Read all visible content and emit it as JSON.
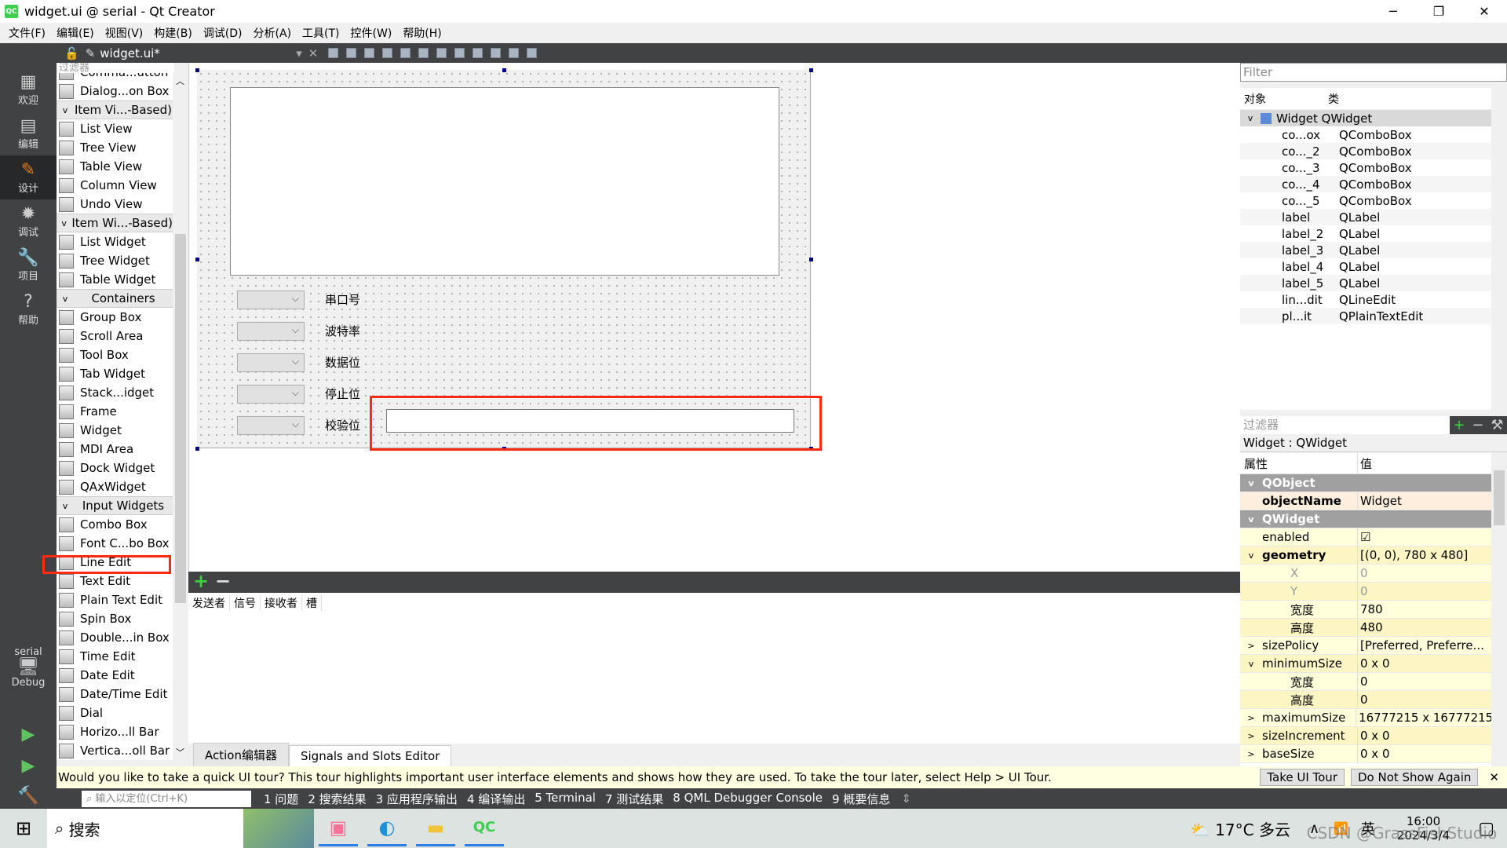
{
  "window": {
    "title": "widget.ui @ serial - Qt Creator",
    "minimize": "─",
    "maximize": "❐",
    "close": "✕",
    "logo": "QC"
  },
  "menu": [
    "文件(F)",
    "编辑(E)",
    "视图(V)",
    "构建(B)",
    "调试(D)",
    "分析(A)",
    "工具(T)",
    "控件(W)",
    "帮助(H)"
  ],
  "editor_toolbar": {
    "file": "widget.ui*",
    "dropdown": "▾",
    "close": "✕"
  },
  "modes": [
    {
      "label": "欢迎",
      "icon": "grid-icon"
    },
    {
      "label": "编辑",
      "icon": "edit-icon"
    },
    {
      "label": "设计",
      "icon": "pencil-icon",
      "active": true
    },
    {
      "label": "调试",
      "icon": "bug-icon"
    },
    {
      "label": "项目",
      "icon": "wrench-icon"
    },
    {
      "label": "帮助",
      "icon": "help-icon"
    }
  ],
  "kit": {
    "project": "serial",
    "config": "Debug"
  },
  "widget_box": {
    "filter_placeholder": "过滤器",
    "items": [
      {
        "label": "Comma...utton"
      },
      {
        "label": "Dialog...on Box"
      },
      {
        "label": "Item Vi...-Based)",
        "category": true
      },
      {
        "label": "List View"
      },
      {
        "label": "Tree View"
      },
      {
        "label": "Table View"
      },
      {
        "label": "Column View"
      },
      {
        "label": "Undo View"
      },
      {
        "label": "Item Wi...-Based)",
        "category": true
      },
      {
        "label": "List Widget"
      },
      {
        "label": "Tree Widget"
      },
      {
        "label": "Table Widget"
      },
      {
        "label": "Containers",
        "category": true
      },
      {
        "label": "Group Box"
      },
      {
        "label": "Scroll Area"
      },
      {
        "label": "Tool Box"
      },
      {
        "label": "Tab Widget"
      },
      {
        "label": "Stack...idget"
      },
      {
        "label": "Frame"
      },
      {
        "label": "Widget"
      },
      {
        "label": "MDI Area"
      },
      {
        "label": "Dock Widget"
      },
      {
        "label": "QAxWidget"
      },
      {
        "label": "Input Widgets",
        "category": true
      },
      {
        "label": "Combo Box"
      },
      {
        "label": "Font C...bo Box"
      },
      {
        "label": "Line Edit",
        "highlighted": true
      },
      {
        "label": "Text Edit"
      },
      {
        "label": "Plain Text Edit"
      },
      {
        "label": "Spin Box"
      },
      {
        "label": "Double...in Box"
      },
      {
        "label": "Time Edit"
      },
      {
        "label": "Date Edit"
      },
      {
        "label": "Date/Time Edit"
      },
      {
        "label": "Dial"
      },
      {
        "label": "Horizo...ll Bar"
      },
      {
        "label": "Vertica...oll Bar"
      }
    ]
  },
  "form": {
    "labels": [
      "串口号",
      "波特率",
      "数据位",
      "停止位",
      "校验位"
    ],
    "line_edit_value": "",
    "highlight_color": "#ff2a10"
  },
  "signals_slots": {
    "add": "+",
    "remove": "−",
    "columns": [
      "发送者",
      "信号",
      "接收者",
      "槽"
    ],
    "tabs": [
      "Action编辑器",
      "Signals and Slots Editor"
    ]
  },
  "object_inspector": {
    "filter_placeholder": "Filter",
    "columns": [
      "对象",
      "类"
    ],
    "root": {
      "name": "Widget",
      "class": "QWidget"
    },
    "children": [
      {
        "name": "co...ox",
        "class": "QComboBox"
      },
      {
        "name": "co..._2",
        "class": "QComboBox"
      },
      {
        "name": "co..._3",
        "class": "QComboBox"
      },
      {
        "name": "co..._4",
        "class": "QComboBox"
      },
      {
        "name": "co..._5",
        "class": "QComboBox"
      },
      {
        "name": "label",
        "class": "QLabel"
      },
      {
        "name": "label_2",
        "class": "QLabel"
      },
      {
        "name": "label_3",
        "class": "QLabel"
      },
      {
        "name": "label_4",
        "class": "QLabel"
      },
      {
        "name": "label_5",
        "class": "QLabel"
      },
      {
        "name": "lin...dit",
        "class": "QLineEdit"
      },
      {
        "name": "pl...it",
        "class": "QPlainTextEdit"
      }
    ]
  },
  "property_editor": {
    "filter_placeholder": "过滤器",
    "class_label": "Widget : QWidget",
    "columns": [
      "属性",
      "值"
    ],
    "rows": [
      {
        "name": "QObject",
        "group": true,
        "exp": "v"
      },
      {
        "name": "objectName",
        "value": "Widget",
        "bold": true,
        "sel": true
      },
      {
        "name": "QWidget",
        "group": true,
        "exp": "v"
      },
      {
        "name": "enabled",
        "value": "☑",
        "check": true
      },
      {
        "name": "geometry",
        "value": "[(0, 0), 780 x 480]",
        "bold": true,
        "exp": "v",
        "alt": true
      },
      {
        "name": "X",
        "value": "0",
        "sub": true,
        "dim": true
      },
      {
        "name": "Y",
        "value": "0",
        "sub": true,
        "dim": true,
        "alt": true
      },
      {
        "name": "宽度",
        "value": "780",
        "sub": true
      },
      {
        "name": "高度",
        "value": "480",
        "sub": true,
        "alt": true
      },
      {
        "name": "sizePolicy",
        "value": "[Preferred, Preferre...",
        "exp": ">"
      },
      {
        "name": "minimumSize",
        "value": "0 x 0",
        "exp": "v",
        "alt": true
      },
      {
        "name": "宽度",
        "value": "0",
        "sub": true
      },
      {
        "name": "高度",
        "value": "0",
        "sub": true,
        "alt": true
      },
      {
        "name": "maximumSize",
        "value": "16777215 x 16777215",
        "exp": ">"
      },
      {
        "name": "sizeIncrement",
        "value": "0 x 0",
        "exp": ">",
        "alt": true
      },
      {
        "name": "baseSize",
        "value": "0 x 0",
        "exp": ">"
      }
    ]
  },
  "tour": {
    "message": "Would you like to take a quick UI tour? This tour highlights important user interface elements and shows how they are used. To take the tour later, select Help > UI Tour.",
    "take": "Take UI Tour",
    "dismiss": "Do Not Show Again",
    "close": "✕"
  },
  "output_panes": {
    "locator_placeholder": "输入以定位(Ctrl+K)",
    "panes": [
      "1 问题",
      "2 搜索结果",
      "3 应用程序输出",
      "4 编译输出",
      "5 Terminal",
      "7 测试结果",
      "8 QML Debugger Console",
      "9 概要信息"
    ]
  },
  "taskbar": {
    "search": "搜索",
    "weather": "17°C 多云",
    "ime": "英",
    "time": "16:00",
    "date": "2024/3/4",
    "watermark": "CSDN @GrassFishStudio"
  }
}
